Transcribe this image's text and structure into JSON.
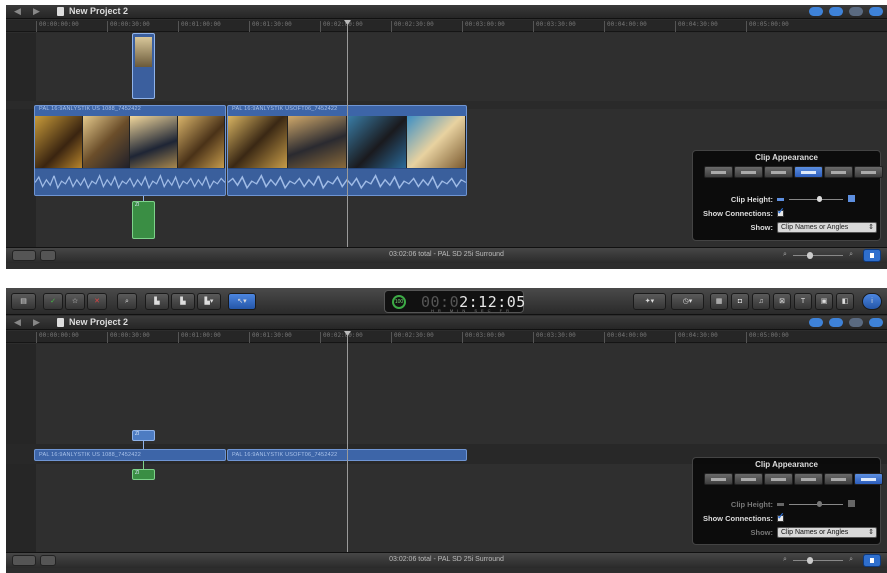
{
  "project_title": "New Project 2",
  "ruler_ticks": [
    "00:00:00:00",
    "00:00:30:00",
    "00:01:00:00",
    "00:01:30:00",
    "00:02:00:00",
    "00:02:30:00",
    "00:03:00:00",
    "00:03:30:00",
    "00:04:00:00",
    "00:04:30:00",
    "00:05:00:00"
  ],
  "clips": {
    "clip1_label": "PAL 16:9ANLYSTIK US 1088_7452422",
    "clip2_label": "PAL 16:9ANLYSTIK USOFT06_7452422",
    "connected_label": "ZI",
    "connected_green_label": "ZI"
  },
  "status": {
    "total": "03:02:06 total - PAL SD 25i Surround",
    "left_button": "",
    "view_button": ""
  },
  "popover": {
    "title": "Clip Appearance",
    "clip_height_label": "Clip Height:",
    "show_connections_label": "Show Connections:",
    "show_label": "Show:",
    "show_value": "Clip Names or Angles"
  },
  "toolbar": {
    "timecode_main": "2:12:05",
    "timecode_faint": "00:0",
    "timecode_sub": "HR MIN SEC FR",
    "timecode_badge": "100"
  },
  "colors": {
    "clip_blue": "#3d65a8",
    "connected_green": "#3a8e44",
    "accent_blue": "#2f6fcd"
  },
  "icons": [
    "back-icon",
    "forward-icon",
    "project-icon",
    "magnifier-icon",
    "arrow-tool-icon",
    "camera-icon",
    "music-icon",
    "title-icon",
    "info-icon"
  ]
}
